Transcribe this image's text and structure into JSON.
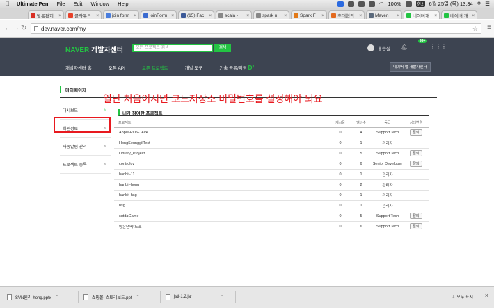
{
  "macbar": {
    "app": "Ultimate Pen",
    "menus": [
      "File",
      "Edit",
      "Window",
      "Help"
    ],
    "battery": "100%",
    "kbd": "한2",
    "datetime": "6월 25일 (목)  13:34"
  },
  "tabs": [
    {
      "label": "받은편지",
      "color": "#d93025"
    },
    {
      "label": "클라우드",
      "color": "#e8412a"
    },
    {
      "label": "join form",
      "color": "#4a7ede"
    },
    {
      "label": "joinForm",
      "color": "#3b6bd0"
    },
    {
      "label": "(15) Fac",
      "color": "#3b5998"
    },
    {
      "label": "scala -",
      "color": "#888888"
    },
    {
      "label": "spark n",
      "color": "#888888"
    },
    {
      "label": "Spark F",
      "color": "#e27a19"
    },
    {
      "label": "초대협의",
      "color": "#e36a1f"
    },
    {
      "label": "Maven",
      "color": "#5b6a7c"
    },
    {
      "label": "네이버개",
      "color": "#23c443"
    },
    {
      "label": "네이버 개",
      "color": "#23c443"
    }
  ],
  "address": {
    "url": "dev.naver.com/my"
  },
  "header": {
    "logo_brand": "NAVER",
    "logo_text": "개발자센터",
    "search_placeholder": "모든 프로젝트 검색",
    "search_button": "검색",
    "username": "홍승실",
    "mail_badge": "99+",
    "app_button": "네이버 앱 개발자센터"
  },
  "menu": [
    {
      "label": "개발자센터 홈"
    },
    {
      "label": "오픈 API"
    },
    {
      "label": "오픈 프로젝트"
    },
    {
      "label": "개발 도구"
    },
    {
      "label": "기술 공유/지원"
    }
  ],
  "menu_d2": "D²",
  "mypage_title": "마이페이지",
  "notice": "일단 처음이시면 코드저장소 비밀번호를 설정해야 되요",
  "sidebar": [
    {
      "label": "대시보드"
    },
    {
      "label": "회원정보"
    },
    {
      "label": "자동알림 관리"
    },
    {
      "label": "프로젝트 등록"
    }
  ],
  "section_title": "내가 참여한 프로젝트",
  "table": {
    "headers": [
      "프로젝트",
      "게시물",
      "멤버수",
      "등급",
      "상태변경"
    ],
    "rows": [
      {
        "project": "Apple-POS-JAVA",
        "posts": "0",
        "members": "4",
        "grade": "Support Tech",
        "action": "탈퇴"
      },
      {
        "project": "HongSeunggilTest",
        "posts": "0",
        "members": "1",
        "grade": "관리자",
        "action": ""
      },
      {
        "project": "Library_Project",
        "posts": "0",
        "members": "5",
        "grade": "Support Tech",
        "action": "탈퇴"
      },
      {
        "project": "controlcv",
        "posts": "0",
        "members": "6",
        "grade": "Senior Developer",
        "action": "탈퇴"
      },
      {
        "project": "hanbit-11",
        "posts": "0",
        "members": "1",
        "grade": "관리자",
        "action": ""
      },
      {
        "project": "hanbit-hong",
        "posts": "0",
        "members": "2",
        "grade": "관리자",
        "action": ""
      },
      {
        "project": "hanbit-hsg",
        "posts": "0",
        "members": "1",
        "grade": "관리자",
        "action": ""
      },
      {
        "project": "hsg",
        "posts": "0",
        "members": "1",
        "grade": "관리자",
        "action": ""
      },
      {
        "project": "sutdaGame",
        "posts": "0",
        "members": "5",
        "grade": "Support Tech",
        "action": "탈퇴"
      },
      {
        "project": "양은냄비*노조",
        "posts": "0",
        "members": "6",
        "grade": "Support Tech",
        "action": "탈퇴"
      }
    ]
  },
  "downloads": [
    {
      "name": "SVN원리-hong.pptx"
    },
    {
      "name": "쇼핑몰_스토리보드.ppt"
    },
    {
      "name": "jstl-1.2.jar"
    }
  ],
  "downloads_show_all": "모두 표시",
  "colors": {
    "accent": "#23c443",
    "nav_bg": "#3d4451",
    "notice_red": "#e8191f"
  }
}
